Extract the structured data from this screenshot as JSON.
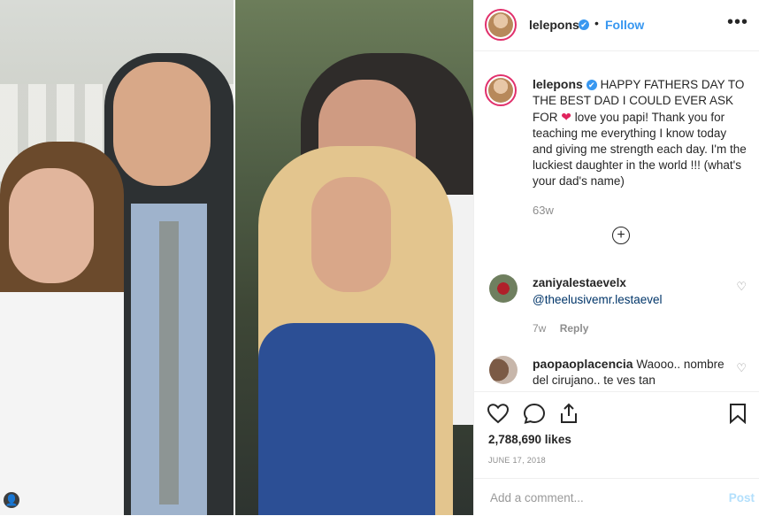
{
  "post": {
    "username": "lelepons",
    "verified_glyph": "✔",
    "follow_label": "Follow",
    "more_label": "•••",
    "dot": "•",
    "caption_parts": {
      "before_heart": "HAPPY FATHERS DAY TO THE BEST DAD I COULD EVER ASK FOR",
      "heart": "❤",
      "after_heart": " love you papi! Thank you for teaching me everything I know today and giving me strength each day. I'm the luckiest daughter in the world !!! (what's your dad's name)"
    },
    "time_ago": "63w",
    "load_more": "+",
    "likes": "2,788,690 likes",
    "date": "JUNE 17, 2018",
    "tag_glyph": "👤"
  },
  "comments": [
    {
      "username": "zaniyalestaevelx",
      "text": "@theelusivemr.lestaevel",
      "time": "7w",
      "reply_label": "Reply",
      "like_glyph": "♡"
    },
    {
      "username": "paopaoplacencia",
      "text": "Waooo.. nombre del cirujano.. te ves tan",
      "like_glyph": "♡"
    }
  ],
  "add_comment": {
    "placeholder": "Add a comment...",
    "post_label": "Post"
  },
  "colors": {
    "accent": "#3897f0",
    "heart": "#e0245e",
    "post_disabled": "#b2dffc"
  }
}
